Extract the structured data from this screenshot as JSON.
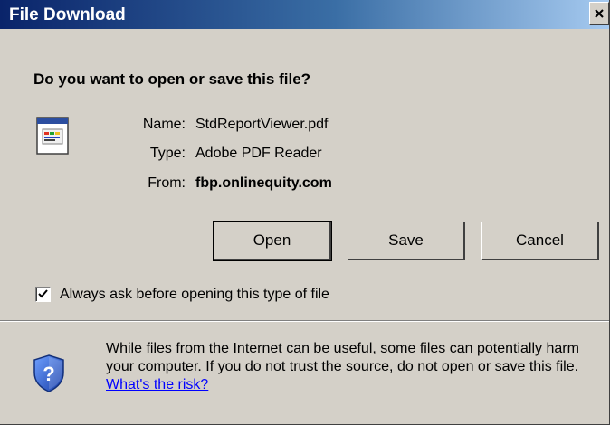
{
  "window": {
    "title": "File Download",
    "close_glyph": "X"
  },
  "question": "Do you want to open or save this file?",
  "file": {
    "icon": "pdf-file-icon",
    "name_label": "Name:",
    "name_value": "StdReportViewer.pdf",
    "type_label": "Type:",
    "type_value": "Adobe PDF Reader",
    "from_label": "From:",
    "from_value": "fbp.onlinequity.com"
  },
  "buttons": {
    "open": "Open",
    "save": "Save",
    "cancel": "Cancel"
  },
  "checkbox": {
    "label": "Always ask before opening this type of file",
    "checked": true
  },
  "warning": {
    "icon": "security-shield-question-icon",
    "text": "While files from the Internet can be useful, some files can potentially harm your computer. If you do not trust the source, do not open or save this file.",
    "link": "What's the risk?"
  },
  "colors": {
    "title_start": "#0a246a",
    "title_end": "#a6caf0",
    "face": "#d4d0c8",
    "link": "#0000ff"
  }
}
